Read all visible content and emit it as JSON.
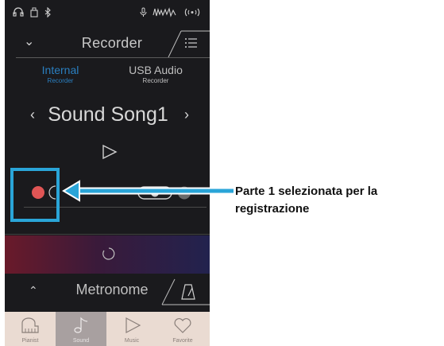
{
  "header": {
    "title": "Recorder"
  },
  "source_tabs": [
    {
      "label": "Internal",
      "sub": "Recorder",
      "active": true
    },
    {
      "label": "USB Audio",
      "sub": "Recorder",
      "active": false
    }
  ],
  "song": {
    "name": "Sound Song1"
  },
  "metronome": {
    "title": "Metronome"
  },
  "nav": [
    {
      "label": "Pianist",
      "icon": "piano-icon"
    },
    {
      "label": "Sound",
      "icon": "music-note-icon",
      "active": true
    },
    {
      "label": "Music",
      "icon": "play-icon"
    },
    {
      "label": "Favorite",
      "icon": "heart-icon"
    }
  ],
  "annotation": {
    "text": "Parte 1 selezionata per la registrazione"
  },
  "colors": {
    "highlight": "#2aa5d8",
    "record": "#e05555",
    "active_tab": "#2a7fc0"
  }
}
